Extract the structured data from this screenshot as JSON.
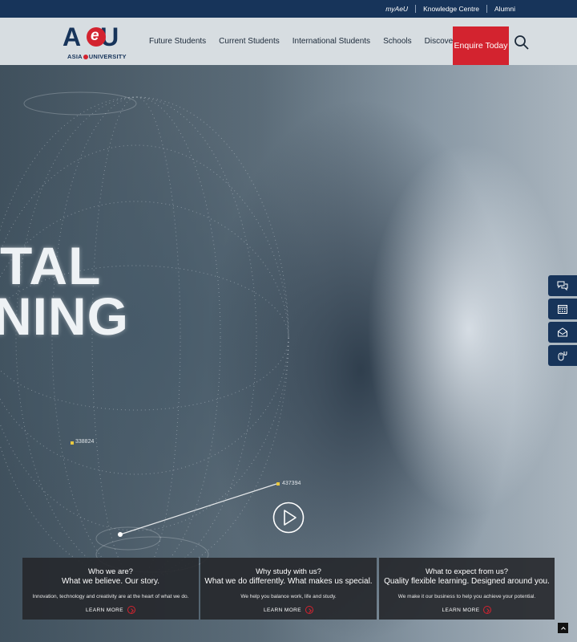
{
  "topbar": {
    "links": [
      "myAeU",
      "Knowledge Centre",
      "Alumni"
    ]
  },
  "logo": {
    "mark_left": "A",
    "mark_e": "e",
    "mark_right": "U",
    "sub_left": "ASIA",
    "sub_right": "UNIVERSITY"
  },
  "nav": {
    "items": [
      "Future Students",
      "Current Students",
      "International Students",
      "Schools",
      "Discover"
    ],
    "cta": "Enquire Today"
  },
  "hero": {
    "line1": "TAL",
    "line2": "NING",
    "label_a": "338824",
    "label_b": "437394"
  },
  "side_icons": [
    "chat-icon",
    "calendar-icon",
    "mail-icon",
    "mouse-icon"
  ],
  "cards": [
    {
      "title": "Who we are?",
      "subtitle": "What we believe. Our story.",
      "desc": "Innovation, technology and creativity are at the heart of what we do.",
      "link": "LEARN MORE"
    },
    {
      "title": "Why study with us?",
      "subtitle": "What we do differently. What makes us special.",
      "desc": "We help you balance work, life and study.",
      "link": "LEARN MORE"
    },
    {
      "title": "What to expect from us?",
      "subtitle": "Quality flexible learning. Designed around you.",
      "desc": "We make it our business to help you achieve your potential.",
      "link": "LEARN MORE"
    }
  ],
  "colors": {
    "navy": "#17345a",
    "red": "#d3232f"
  }
}
